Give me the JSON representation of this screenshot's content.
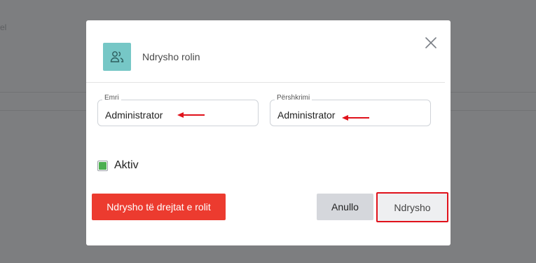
{
  "background": {
    "text": "el"
  },
  "modal": {
    "title": "Ndrysho rolin",
    "icon": "users-icon",
    "fields": [
      {
        "label": "Emri",
        "value": "Administrator"
      },
      {
        "label": "Përshkrimi",
        "value": "Administrator"
      }
    ],
    "active": {
      "label": "Aktiv",
      "checked": true
    },
    "buttons": {
      "permissions": "Ndrysho të drejtat e rolit",
      "cancel": "Anullo",
      "submit": "Ndrysho"
    }
  },
  "colors": {
    "overlay": "#7d7e80",
    "icon_bg": "#76c7c6",
    "danger": "#ec3b2f",
    "checkbox": "#4caf50",
    "annotation": "#e0121b"
  }
}
